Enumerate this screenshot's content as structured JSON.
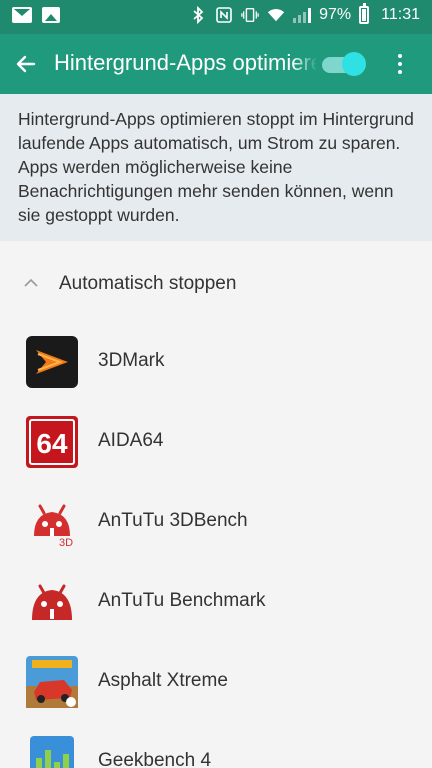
{
  "status_bar": {
    "battery": "97%",
    "time": "11:31",
    "icons": [
      "mail-icon",
      "image-icon",
      "bluetooth-icon",
      "nfc-icon",
      "vibrate-icon",
      "wifi-icon",
      "signal-icon",
      "battery-icon"
    ]
  },
  "app_bar": {
    "title": "Hintergrund-Apps optimieren",
    "toggle_on": true,
    "accent": "#1f9a7c"
  },
  "description": "Hintergrund-Apps optimieren stoppt im Hintergrund laufende Apps automatisch, um Strom zu sparen. Apps werden mögli­cherweise keine Benachrichtigungen mehr senden können, wenn sie gestoppt wurden.",
  "section": {
    "label": "Automatisch stoppen"
  },
  "apps": [
    {
      "label": "3DMark",
      "icon": "3dmark-icon"
    },
    {
      "label": "AIDA64",
      "icon": "aida64-icon",
      "icon_text": "64"
    },
    {
      "label": "AnTuTu 3DBench",
      "icon": "antutu-3dbench-icon",
      "icon_text": "3D"
    },
    {
      "label": "AnTuTu Benchmark",
      "icon": "antutu-benchmark-icon"
    },
    {
      "label": "Asphalt Xtreme",
      "icon": "asphalt-xtreme-icon"
    },
    {
      "label": "Geekbench 4",
      "icon": "geekbench-icon"
    }
  ]
}
